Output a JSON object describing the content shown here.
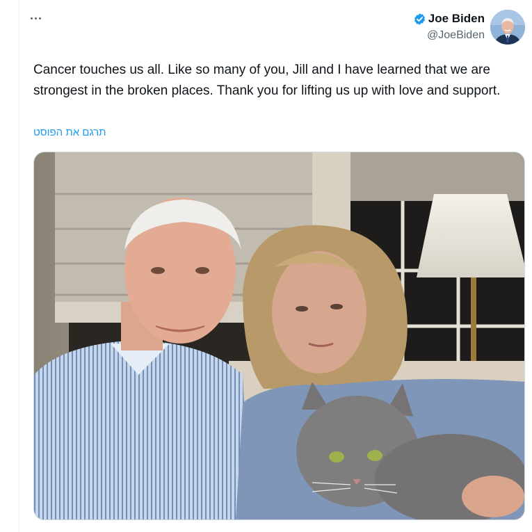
{
  "tweet": {
    "author": {
      "name": "Joe Biden",
      "handle": "@JoeBiden",
      "verified": true,
      "verified_icon": "verified-badge-icon",
      "verified_color": "#1d9bf0"
    },
    "more_icon": "more-options-icon",
    "text": "Cancer touches us all. Like so many of you, Jill and I have learned that we are strongest in the broken places. Thank you for lifting us up with love and support.",
    "translate_label": "תרגם את הפוסט",
    "link_color": "#1d9bf0"
  }
}
